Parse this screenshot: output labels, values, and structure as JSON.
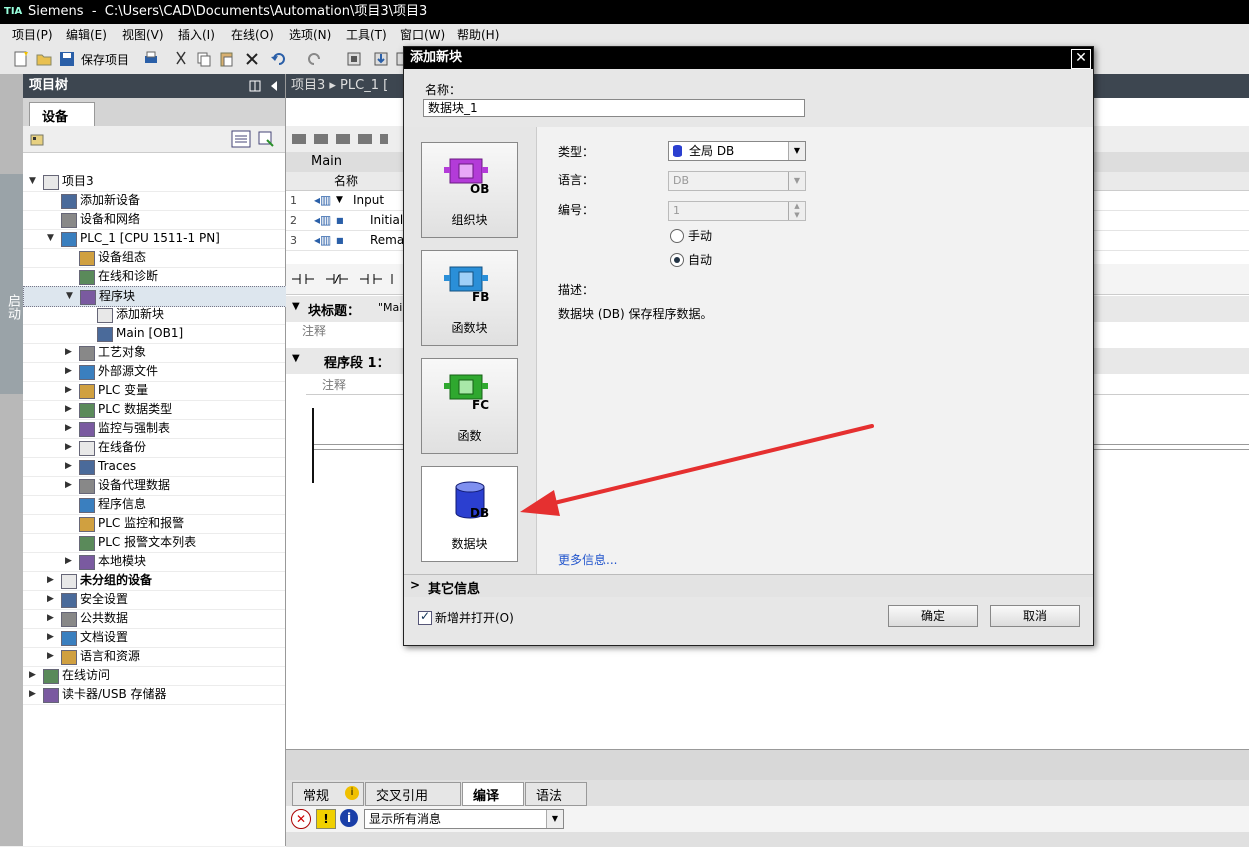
{
  "window": {
    "app": "Siemens",
    "separator": "-",
    "path": "C:\\Users\\CAD\\Documents\\Automation\\项目3\\项目3"
  },
  "menu": [
    "项目(P)",
    "编辑(E)",
    "视图(V)",
    "插入(I)",
    "在线(O)",
    "选项(N)",
    "工具(T)",
    "窗口(W)",
    "帮助(H)"
  ],
  "toolbar": {
    "save_label": "保存项目"
  },
  "side_tab": "启动",
  "project_tree": {
    "title": "项目树",
    "tab": "设备",
    "items": [
      {
        "label": "项目3",
        "level": 0,
        "expanded": true
      },
      {
        "label": "添加新设备",
        "level": 1
      },
      {
        "label": "设备和网络",
        "level": 1
      },
      {
        "label": "PLC_1 [CPU 1511-1 PN]",
        "level": 1,
        "expanded": true
      },
      {
        "label": "设备组态",
        "level": 2
      },
      {
        "label": "在线和诊断",
        "level": 2
      },
      {
        "label": "程序块",
        "level": 2,
        "expanded": true,
        "selected": true
      },
      {
        "label": "添加新块",
        "level": 3
      },
      {
        "label": "Main [OB1]",
        "level": 3
      },
      {
        "label": "工艺对象",
        "level": 2,
        "collapsed": true
      },
      {
        "label": "外部源文件",
        "level": 2,
        "collapsed": true
      },
      {
        "label": "PLC 变量",
        "level": 2,
        "collapsed": true
      },
      {
        "label": "PLC 数据类型",
        "level": 2,
        "collapsed": true
      },
      {
        "label": "监控与强制表",
        "level": 2,
        "collapsed": true
      },
      {
        "label": "在线备份",
        "level": 2,
        "collapsed": true
      },
      {
        "label": "Traces",
        "level": 2,
        "collapsed": true
      },
      {
        "label": "设备代理数据",
        "level": 2,
        "collapsed": true
      },
      {
        "label": "程序信息",
        "level": 2
      },
      {
        "label": "PLC 监控和报警",
        "level": 2
      },
      {
        "label": "PLC 报警文本列表",
        "level": 2
      },
      {
        "label": "本地模块",
        "level": 2,
        "collapsed": true
      },
      {
        "label": "未分组的设备",
        "level": 1,
        "collapsed": true,
        "bold": true
      },
      {
        "label": "安全设置",
        "level": 1,
        "collapsed": true
      },
      {
        "label": "公共数据",
        "level": 1,
        "collapsed": true
      },
      {
        "label": "文档设置",
        "level": 1,
        "collapsed": true
      },
      {
        "label": "语言和资源",
        "level": 1,
        "collapsed": true
      },
      {
        "label": "在线访问",
        "level": 0,
        "collapsed": true
      },
      {
        "label": "读卡器/USB 存储器",
        "level": 0,
        "collapsed": true
      }
    ]
  },
  "editor": {
    "breadcrumb": "项目3 ▸ PLC_1 [",
    "block_name": "Main",
    "col_name": "名称",
    "rows": [
      {
        "n": "1",
        "name": "Input"
      },
      {
        "n": "2",
        "name": "Initial_"
      },
      {
        "n": "3",
        "name": "Rema"
      }
    ],
    "block_title": "块标题：",
    "block_title_value": "\"Mai",
    "comment": "注释",
    "network": "程序段 1：",
    "network_comment": "注释"
  },
  "inspector": {
    "tabs": [
      "常规",
      "交叉引用",
      "编译",
      "语法"
    ],
    "filter": "显示所有消息"
  },
  "dialog": {
    "title": "添加新块",
    "name_label": "名称：",
    "name_value": "数据块_1",
    "block_types": [
      {
        "badge": "OB",
        "label": "组织块",
        "color": "#b33bd8"
      },
      {
        "badge": "FB",
        "label": "函数块",
        "color": "#2a8fd8"
      },
      {
        "badge": "FC",
        "label": "函数",
        "color": "#2fa82f"
      },
      {
        "badge": "DB",
        "label": "数据块",
        "color": "#2b3fd0",
        "selected": true
      }
    ],
    "type_label": "类型：",
    "type_value": "全局 DB",
    "language_label": "语言：",
    "language_value": "DB",
    "number_label": "编号：",
    "number_value": "1",
    "manual_label": "手动",
    "auto_label": "自动",
    "desc_label": "描述：",
    "desc_text": "数据块 (DB) 保存程序数据。",
    "more_info": "更多信息...",
    "other_info": "其它信息",
    "open_label": "新增并打开(O)",
    "ok": "确定",
    "cancel": "取消"
  }
}
